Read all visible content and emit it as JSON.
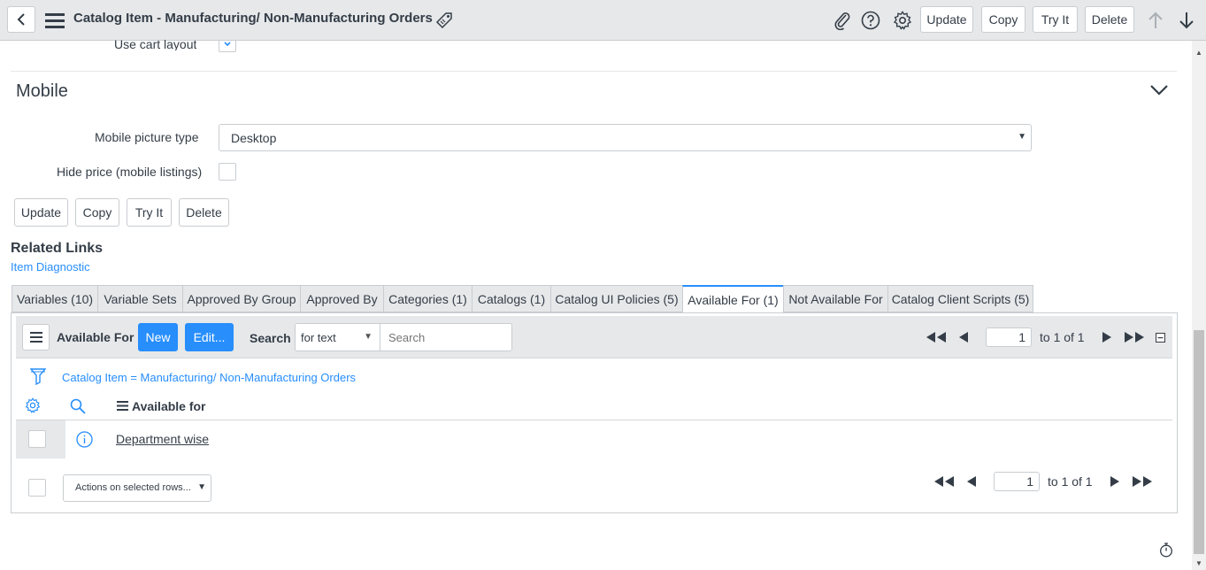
{
  "header": {
    "title": "Catalog Item - Manufacturing/ Non-Manufacturing Orders",
    "buttons": {
      "update": "Update",
      "copy": "Copy",
      "try_it": "Try It",
      "delete": "Delete"
    }
  },
  "form": {
    "cut_off_label": "Use cart layout",
    "section_title": "Mobile",
    "mobile_picture_type_label": "Mobile picture type",
    "mobile_picture_type_value": "Desktop",
    "hide_price_label": "Hide price (mobile listings)",
    "buttons": {
      "update": "Update",
      "copy": "Copy",
      "try_it": "Try It",
      "delete": "Delete"
    }
  },
  "related_links": {
    "title": "Related Links",
    "item_diagnostic": "Item Diagnostic"
  },
  "tabs": [
    {
      "label": "Variables (10)"
    },
    {
      "label": "Variable Sets"
    },
    {
      "label": "Approved By Group"
    },
    {
      "label": "Approved By"
    },
    {
      "label": "Categories (1)"
    },
    {
      "label": "Catalogs (1)"
    },
    {
      "label": "Catalog UI Policies (5)"
    },
    {
      "label": "Available For (1)"
    },
    {
      "label": "Not Available For"
    },
    {
      "label": "Catalog Client Scripts (5)"
    }
  ],
  "related_list": {
    "title": "Available For",
    "new_label": "New",
    "edit_label": "Edit...",
    "search_label": "Search",
    "search_field_value": "for text",
    "search_placeholder": "Search",
    "page_value": "1",
    "page_range": "to 1 of 1",
    "filter_breadcrumb": "Catalog Item = Manufacturing/ Non-Manufacturing Orders",
    "column_header": "Available for",
    "rows": [
      {
        "available_for": "Department wise"
      }
    ],
    "actions_select": "Actions on selected rows...",
    "bottom_page_value": "1",
    "bottom_page_range": "to 1 of 1"
  },
  "colors": {
    "accent": "#278efc",
    "header_bg": "#e6e8ea",
    "border": "#c9cdd1",
    "text": "#343d47"
  }
}
